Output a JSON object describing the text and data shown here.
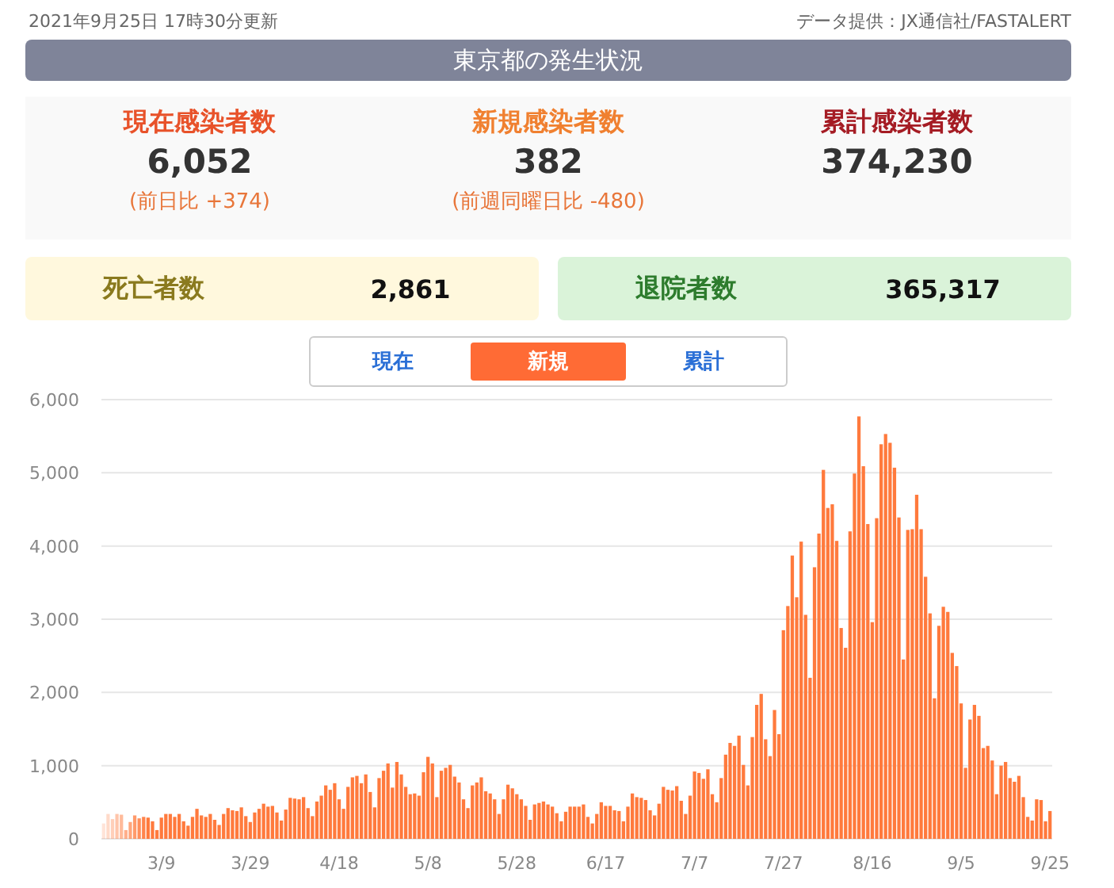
{
  "header": {
    "updated": "2021年9月25日 17時30分更新",
    "source": "データ提供：JX通信社/FASTALERT"
  },
  "title": "東京都の発生状況",
  "stats": [
    {
      "kind": "current",
      "label": "現在感染者数",
      "value": "6,052",
      "note": "(前日比 +374)"
    },
    {
      "kind": "new",
      "label": "新規感染者数",
      "value": "382",
      "note": "(前週同曜日比 -480)"
    },
    {
      "kind": "total",
      "label": "累計感染者数",
      "value": "374,230"
    }
  ],
  "cards": [
    {
      "kind": "deaths",
      "label": "死亡者数",
      "value": "2,861"
    },
    {
      "kind": "recovered",
      "label": "退院者数",
      "value": "365,317"
    }
  ],
  "tabs": [
    {
      "label": "現在",
      "selected": false
    },
    {
      "label": "新規",
      "selected": true
    },
    {
      "label": "累計",
      "selected": false
    }
  ],
  "chart": {
    "chart_data": {
      "type": "bar",
      "ylim": [
        0,
        6000
      ],
      "grid": true,
      "yticks": [
        {
          "value": 0,
          "label": "0"
        },
        {
          "value": 1000,
          "label": "1,000"
        },
        {
          "value": 2000,
          "label": "2,000"
        },
        {
          "value": 3000,
          "label": "3,000"
        },
        {
          "value": 4000,
          "label": "4,000"
        },
        {
          "value": 5000,
          "label": "5,000"
        },
        {
          "value": 6000,
          "label": "6,000"
        }
      ],
      "categories": [
        null,
        null,
        null,
        null,
        null,
        null,
        null,
        null,
        null,
        null,
        null,
        null,
        null,
        "3/9",
        null,
        null,
        null,
        null,
        null,
        null,
        null,
        null,
        null,
        null,
        null,
        null,
        null,
        null,
        null,
        null,
        null,
        null,
        null,
        "3/29",
        null,
        null,
        null,
        null,
        null,
        null,
        null,
        null,
        null,
        null,
        null,
        null,
        null,
        null,
        null,
        null,
        null,
        null,
        null,
        "4/18",
        null,
        null,
        null,
        null,
        null,
        null,
        null,
        null,
        null,
        null,
        null,
        null,
        null,
        null,
        null,
        null,
        null,
        null,
        null,
        "5/8",
        null,
        null,
        null,
        null,
        null,
        null,
        null,
        null,
        null,
        null,
        null,
        null,
        null,
        null,
        null,
        null,
        null,
        null,
        null,
        "5/28",
        null,
        null,
        null,
        null,
        null,
        null,
        null,
        null,
        null,
        null,
        null,
        null,
        null,
        null,
        null,
        null,
        null,
        null,
        null,
        "6/17",
        null,
        null,
        null,
        null,
        null,
        null,
        null,
        null,
        null,
        null,
        null,
        null,
        null,
        null,
        null,
        null,
        null,
        null,
        null,
        "7/7",
        null,
        null,
        null,
        null,
        null,
        null,
        null,
        null,
        null,
        null,
        null,
        null,
        null,
        null,
        null,
        null,
        null,
        null,
        null,
        "7/27",
        null,
        null,
        null,
        null,
        null,
        null,
        null,
        null,
        null,
        null,
        null,
        null,
        null,
        null,
        null,
        null,
        null,
        null,
        null,
        "8/16",
        null,
        null,
        null,
        null,
        null,
        null,
        null,
        null,
        null,
        null,
        null,
        null,
        null,
        null,
        null,
        null,
        null,
        null,
        null,
        "9/5",
        null,
        null,
        null,
        null,
        null,
        null,
        null,
        null,
        null,
        null,
        null,
        null,
        null,
        null,
        null,
        null,
        null,
        null,
        null,
        "9/25"
      ],
      "series": [
        {
          "color": "#ff7a3d",
          "values": [
            210,
            340,
            270,
            340,
            330,
            120,
            230,
            320,
            280,
            300,
            290,
            240,
            120,
            290,
            340,
            340,
            300,
            340,
            240,
            180,
            300,
            410,
            320,
            300,
            340,
            260,
            190,
            340,
            420,
            390,
            380,
            430,
            310,
            230,
            360,
            410,
            480,
            440,
            450,
            360,
            250,
            400,
            560,
            550,
            540,
            570,
            420,
            310,
            510,
            590,
            730,
            670,
            760,
            540,
            410,
            710,
            840,
            860,
            760,
            880,
            640,
            430,
            830,
            930,
            1030,
            700,
            1050,
            880,
            710,
            610,
            620,
            590,
            910,
            1120,
            1030,
            570,
            930,
            970,
            1010,
            850,
            770,
            540,
            420,
            730,
            770,
            840,
            650,
            620,
            540,
            340,
            540,
            740,
            690,
            610,
            540,
            450,
            260,
            470,
            490,
            510,
            470,
            440,
            350,
            240,
            370,
            440,
            440,
            440,
            470,
            300,
            210,
            340,
            500,
            450,
            450,
            390,
            380,
            240,
            440,
            620,
            570,
            560,
            530,
            390,
            320,
            480,
            710,
            670,
            660,
            720,
            520,
            340,
            590,
            920,
            900,
            820,
            950,
            610,
            500,
            830,
            1150,
            1310,
            1270,
            1410,
            1010,
            730,
            1390,
            1830,
            1980,
            1360,
            1130,
            1760,
            1430,
            2850,
            3180,
            3870,
            3300,
            4060,
            3060,
            2200,
            3710,
            4170,
            5040,
            4520,
            4570,
            4070,
            2880,
            2610,
            4200,
            4990,
            5770,
            5090,
            4300,
            2960,
            4380,
            5390,
            5530,
            5410,
            5070,
            4390,
            2450,
            4220,
            4230,
            4700,
            4230,
            3580,
            3080,
            1920,
            2910,
            3170,
            3100,
            2540,
            2360,
            1850,
            970,
            1630,
            1830,
            1680,
            1240,
            1270,
            1070,
            610,
            1000,
            1050,
            830,
            780,
            860,
            570,
            300,
            250,
            540,
            530,
            240,
            380
          ]
        }
      ]
    }
  }
}
